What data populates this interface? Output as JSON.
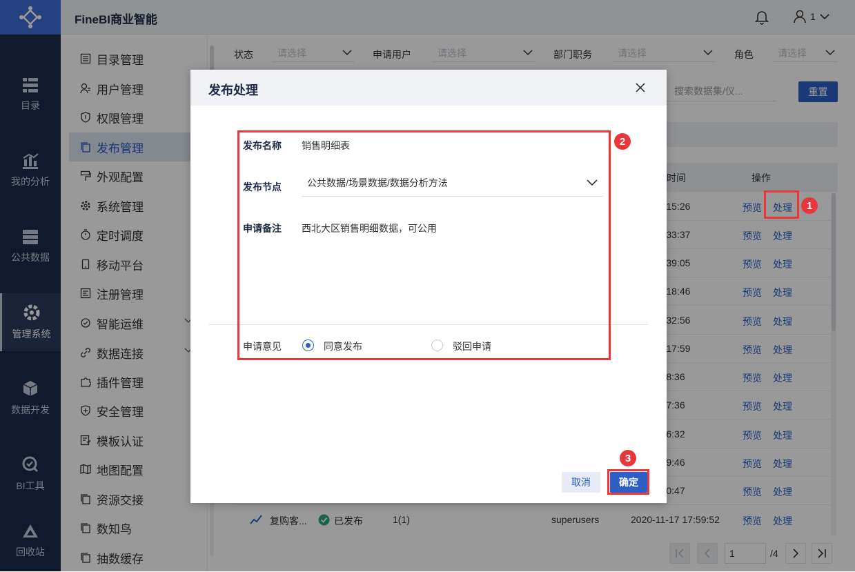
{
  "app": {
    "title": "FineBI商业智能"
  },
  "header": {
    "user_count": "1"
  },
  "leftnav": {
    "items": [
      {
        "label": "目录",
        "icon": "catalog-icon"
      },
      {
        "label": "我的分析",
        "icon": "analysis-icon"
      },
      {
        "label": "公共数据",
        "icon": "database-icon"
      },
      {
        "label": "管理系统",
        "icon": "gear-icon",
        "active": true
      },
      {
        "label": "数据开发",
        "icon": "cube-icon"
      },
      {
        "label": "BI工具",
        "icon": "tool-icon"
      },
      {
        "label": "回收站",
        "icon": "recycle-icon"
      }
    ]
  },
  "submenu": {
    "items": [
      {
        "label": "目录管理"
      },
      {
        "label": "用户管理"
      },
      {
        "label": "权限管理"
      },
      {
        "label": "发布管理",
        "active": true
      },
      {
        "label": "外观配置"
      },
      {
        "label": "系统管理"
      },
      {
        "label": "定时调度"
      },
      {
        "label": "移动平台"
      },
      {
        "label": "注册管理"
      },
      {
        "label": "智能运维"
      },
      {
        "label": "数据连接"
      },
      {
        "label": "插件管理"
      },
      {
        "label": "安全管理"
      },
      {
        "label": "模板认证"
      },
      {
        "label": "地图配置"
      },
      {
        "label": "资源交接"
      },
      {
        "label": "数知鸟"
      },
      {
        "label": "抽数缓存"
      }
    ]
  },
  "filters": {
    "status_label": "状态",
    "applicant_label": "申请用户",
    "dept_label": "部门职务",
    "role_label": "角色",
    "placeholder": "请选择",
    "search_placeholder": "搜索数据集/仪...",
    "reset_label": "重置"
  },
  "table": {
    "col_time": "时间",
    "col_ops": "操作",
    "preview_label": "预览",
    "handle_label": "处理",
    "times": [
      "6-27 14:15:26",
      "6-13 17:33:37",
      "4-19 15:39:05",
      "4-19 14:18:46",
      "4-13 16:32:56",
      "9-26 10:17:59",
      "-25 16:48:36",
      "-24 21:57:36",
      "-24 21:56:32",
      "-23 14:59:46",
      "-17 18:00:47"
    ],
    "last_row": {
      "name": "复购客...",
      "status": "已发布",
      "count": "1(1)",
      "user": "superusers",
      "time": "2020-11-17 17:59:52"
    }
  },
  "pager": {
    "current": "1",
    "total": "/4"
  },
  "dialog": {
    "title": "发布处理",
    "name_label": "发布名称",
    "name_value": "销售明细表",
    "node_label": "发布节点",
    "node_value": "公共数据/场景数据/数据分析方法",
    "remark_label": "申请备注",
    "remark_value": "西北大区销售明细数据，可公用",
    "opinion_label": "申请意见",
    "agree_label": "同意发布",
    "reject_label": "驳回申请",
    "cancel_label": "取消",
    "ok_label": "确定"
  },
  "badges": [
    "1",
    "2",
    "3"
  ],
  "colors": {
    "primary": "#2e5fc6",
    "nav_bg": "#1d2a4a",
    "highlight": "#e8363a"
  }
}
